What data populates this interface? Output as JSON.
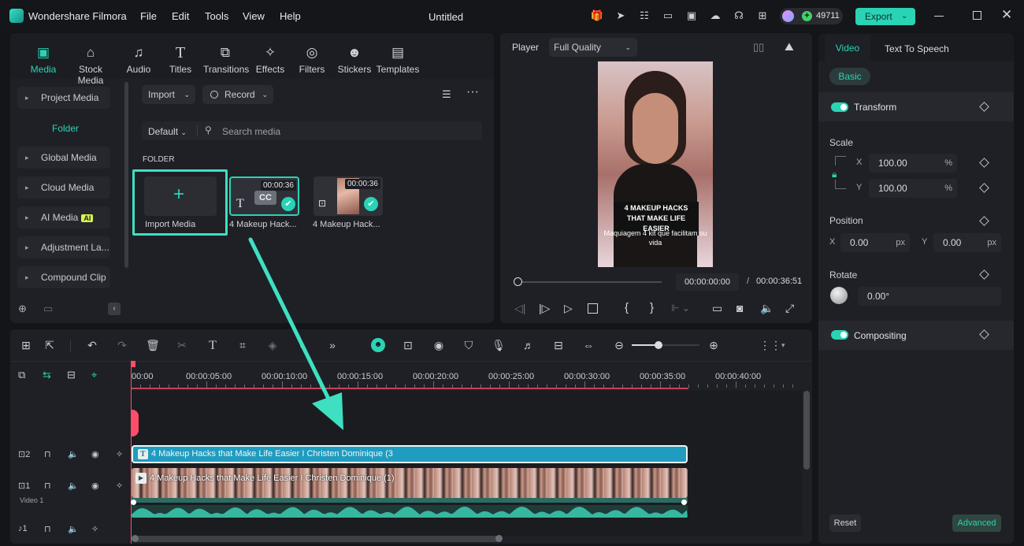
{
  "app": {
    "name": "Wondershare Filmora",
    "doc_title": "Untitled",
    "credits": "49711",
    "export_label": "Export"
  },
  "menu": [
    "File",
    "Edit",
    "Tools",
    "View",
    "Help"
  ],
  "media_tabs": [
    {
      "label": "Media",
      "icon": "media-icon"
    },
    {
      "label": "Stock Media",
      "icon": "stock-media-icon"
    },
    {
      "label": "Audio",
      "icon": "audio-icon"
    },
    {
      "label": "Titles",
      "icon": "titles-icon"
    },
    {
      "label": "Transitions",
      "icon": "transitions-icon"
    },
    {
      "label": "Effects",
      "icon": "effects-icon"
    },
    {
      "label": "Filters",
      "icon": "filters-icon"
    },
    {
      "label": "Stickers",
      "icon": "stickers-icon"
    },
    {
      "label": "Templates",
      "icon": "templates-icon"
    }
  ],
  "sidebar": {
    "project_media": "Project Media",
    "folder": "Folder",
    "items": [
      "Global Media",
      "Cloud Media",
      "AI Media",
      "Adjustment La...",
      "Compound Clip"
    ],
    "ai_badge": "AI"
  },
  "media": {
    "import_label": "Import",
    "record_label": "Record",
    "sort_label": "Default",
    "search_placeholder": "Search media",
    "section": "FOLDER",
    "import_tile": "Import Media",
    "items": [
      {
        "name": "4 Makeup Hack...",
        "duration": "00:00:36",
        "badge": "CC"
      },
      {
        "name": "4 Makeup Hack...",
        "duration": "00:00:36"
      }
    ]
  },
  "player": {
    "label": "Player",
    "quality": "Full Quality",
    "overlay_title_1": "4 MAKEUP HACKS",
    "overlay_title_2": "THAT MAKE LIFE EASIER",
    "overlay_sub": "Maquiagem 4 kit que facilitam su vida",
    "current_time": "00:00:00:00",
    "separator": "/",
    "total_time": "00:00:36:51",
    "progress": 0.0
  },
  "properties": {
    "tabs": [
      "Video",
      "Text To Speech"
    ],
    "basic": "Basic",
    "transform": "Transform",
    "scale": "Scale",
    "scale_x": "100.00",
    "scale_y": "100.00",
    "percent": "%",
    "position": "Position",
    "pos_x": "0.00",
    "pos_y": "0.00",
    "px": "px",
    "x_label": "X",
    "y_label": "Y",
    "rotate": "Rotate",
    "rotate_value": "0.00°",
    "compositing": "Compositing",
    "reset": "Reset",
    "advanced": "Advanced"
  },
  "timeline": {
    "ticks": [
      "00:00",
      "00:00:05:00",
      "00:00:10:00",
      "00:00:15:00",
      "00:00:20:00",
      "00:00:25:00",
      "00:00:30:00",
      "00:00:35:00",
      "00:00:40:00"
    ],
    "track2_num": "2",
    "track1_num": "1",
    "audio_num": "1",
    "video_label": "Video 1",
    "caption_clip": "4 Makeup Hacks that Make Life Easier I Christen Dominique (3",
    "video_clip": "4 Makeup Hacks that Make Life Easier I Christen Dominique (1)",
    "zoom_level": 0.4
  },
  "colors": {
    "accent": "#2ad3b5",
    "caption_clip": "#1f9cbf",
    "playhead": "#ff4d6a"
  }
}
